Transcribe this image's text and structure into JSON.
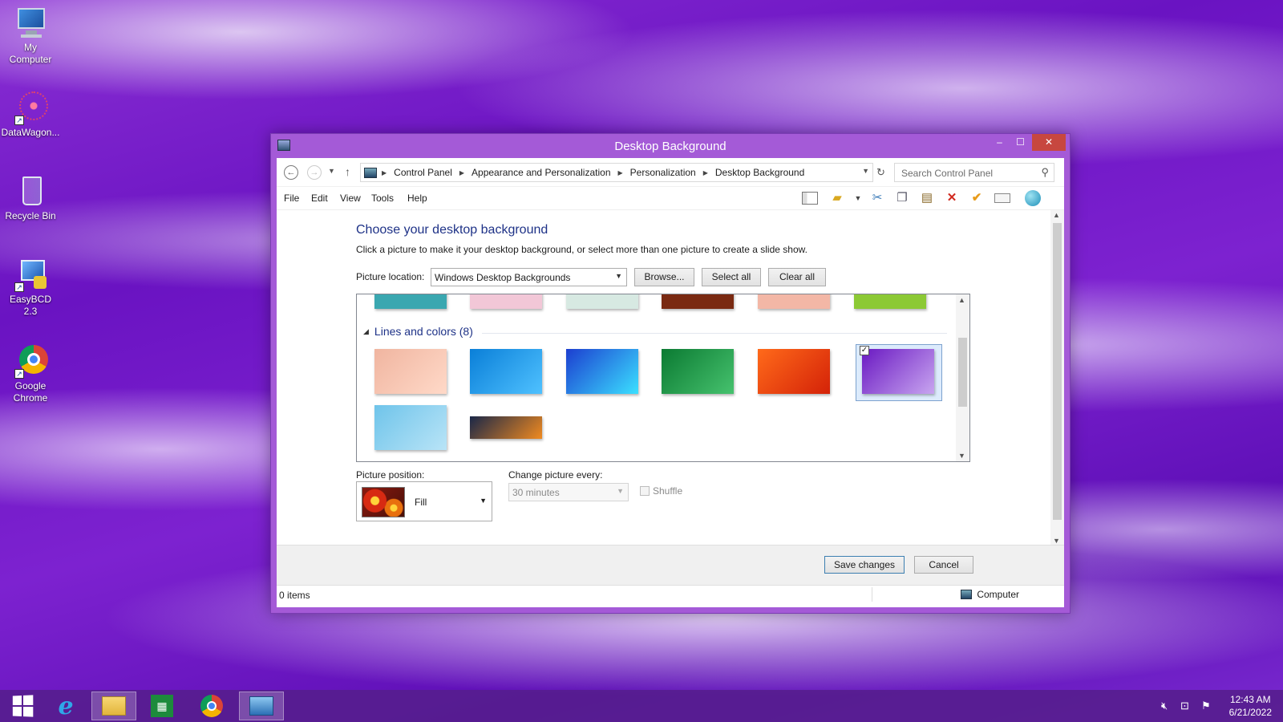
{
  "desktop": {
    "icons": [
      {
        "label": "My\nComputer"
      },
      {
        "label": "DataWagon..."
      },
      {
        "label": "Recycle Bin"
      },
      {
        "label": "EasyBCD 2.3"
      },
      {
        "label": "Google\nChrome"
      }
    ]
  },
  "window": {
    "title": "Desktop Background",
    "controls": {
      "minimize": "–",
      "maximize": "☐",
      "close": "✕"
    },
    "breadcrumb": [
      "Control Panel",
      "Appearance and Personalization",
      "Personalization",
      "Desktop Background"
    ],
    "search_placeholder": "Search Control Panel",
    "menu": [
      "File",
      "Edit",
      "View",
      "Tools",
      "Help"
    ],
    "toolbar_icons": [
      "layout-pane-icon",
      "folder-icon",
      "cut-icon",
      "copy-icon",
      "paste-icon",
      "delete-icon",
      "checkmark-icon",
      "rename-icon",
      "globe-icon"
    ]
  },
  "page": {
    "heading": "Choose your desktop background",
    "description": "Click a picture to make it your desktop background, or select more than one picture to create a slide show.",
    "picture_location_label": "Picture location:",
    "picture_location_value": "Windows Desktop Backgrounds",
    "browse_label": "Browse...",
    "select_all_label": "Select all",
    "clear_all_label": "Clear all",
    "gallery": {
      "group_title": "Lines and colors (8)",
      "selected_index": 5,
      "previous_group_colors": [
        "#3aa7b0",
        "#f2c7d7",
        "#d7e9e2",
        "#7a2a12",
        "#f3b7a6",
        "#8cc935"
      ],
      "thumbnails": [
        {
          "name": "cartoon-wallpaper",
          "colors": [
            "#f0b5a0",
            "#ffd9c8"
          ]
        },
        {
          "name": "blue-lines-wallpaper",
          "colors": [
            "#0a7fd8",
            "#4fc1ff"
          ]
        },
        {
          "name": "blue-shards-wallpaper",
          "colors": [
            "#1c3ed0",
            "#3be0ff"
          ]
        },
        {
          "name": "green-lines-wallpaper",
          "colors": [
            "#0b7a32",
            "#46c26e"
          ]
        },
        {
          "name": "orange-swirl-wallpaper",
          "colors": [
            "#ff6a1a",
            "#d42208"
          ]
        },
        {
          "name": "purple-waves-wallpaper",
          "colors": [
            "#6a19c2",
            "#c8a5f0"
          ]
        },
        {
          "name": "light-blue-lines-wallpaper",
          "colors": [
            "#6fc4ea",
            "#b9e4f7"
          ]
        },
        {
          "name": "dark-orange-stripes-wallpaper",
          "colors": [
            "#1a2748",
            "#f08a20"
          ]
        }
      ]
    },
    "picture_position_label": "Picture position:",
    "picture_position_value": "Fill",
    "change_picture_label": "Change picture every:",
    "change_picture_value": "30 minutes",
    "shuffle_label": "Shuffle",
    "save_label": "Save changes",
    "cancel_label": "Cancel"
  },
  "statusbar": {
    "items": "0 items",
    "location": "Computer"
  },
  "taskbar": {
    "apps": [
      "start-icon",
      "internet-explorer-icon",
      "file-explorer-icon",
      "store-icon",
      "chrome-icon",
      "control-panel-icon"
    ],
    "time": "12:43 AM",
    "date": "6/21/2022"
  }
}
